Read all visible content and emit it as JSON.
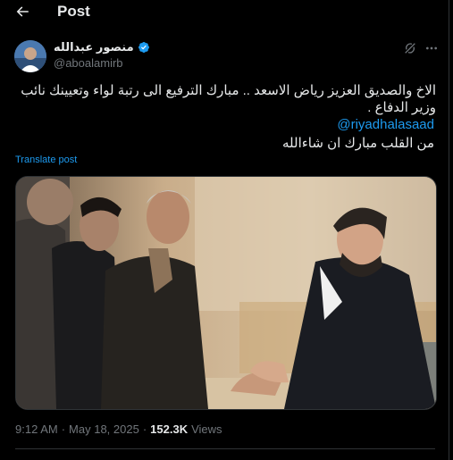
{
  "header": {
    "title": "Post"
  },
  "author": {
    "name": "منصور عبدالله",
    "handle": "@aboalamirb"
  },
  "tweet": {
    "text_line1": "الاخ والصديق العزيز رياض الاسعد .. مبارك الترفيع الى رتبة لواء وتعيينك نائب وزير الدفاع .",
    "mention": "@riyadhalasaad",
    "text_line2": "من القلب مبارك ان شاءالله",
    "translate": "Translate post"
  },
  "meta": {
    "time": "9:12 AM",
    "separator": "·",
    "date": "May 18, 2025",
    "separator2": "·",
    "views_count": "152.3K",
    "views_label": "Views"
  },
  "colors": {
    "background": "#000000",
    "text": "#e7e9ea",
    "muted": "#71767b",
    "accent": "#1d9bf0",
    "border": "#2f3336"
  },
  "icons": {
    "back": "arrow-left-icon",
    "verified": "verified-badge-icon",
    "grok": "grok-icon",
    "more": "more-horizontal-icon"
  }
}
